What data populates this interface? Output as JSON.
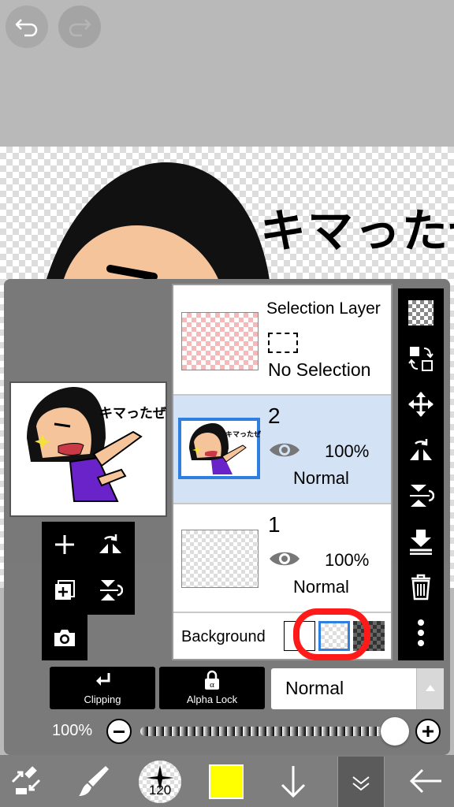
{
  "top_bar": {
    "undo_icon": "undo-icon",
    "redo_icon": "redo-icon"
  },
  "canvas": {
    "sticker_text": "キマったぜ"
  },
  "layers_panel": {
    "selection_layer": {
      "title": "Selection Layer",
      "status": "No Selection"
    },
    "layers": [
      {
        "name": "2",
        "opacity": "100%",
        "blend": "Normal",
        "selected": true
      },
      {
        "name": "1",
        "opacity": "100%",
        "blend": "Normal",
        "selected": false
      }
    ],
    "background_label": "Background"
  },
  "layer_controls": {
    "clipping_label": "Clipping",
    "alpha_lock_label": "Alpha Lock",
    "blend_mode": "Normal",
    "opacity_label": "100%"
  },
  "bottom_toolbar": {
    "brush_size": "120",
    "color": "#ffff00"
  },
  "colors": {
    "accent": "#2f7fe0",
    "highlight_circle": "#ff1a1a",
    "selected_row": "#d3e2f5"
  }
}
